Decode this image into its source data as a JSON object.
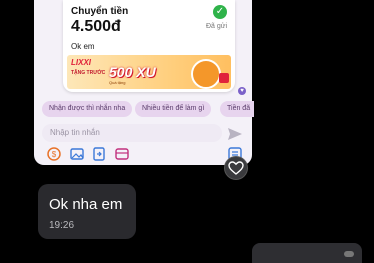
{
  "transfer": {
    "title": "Chuyển tiền",
    "amount": "4.500đ",
    "status": "Đã gửi",
    "note": "Ok em"
  },
  "promo": {
    "brand": "LIXXI",
    "tagline": "TẶNG TRƯỚC",
    "amount": "500 XU",
    "small": "Quà tặng"
  },
  "suggestions": [
    "Nhận được thì nhắn nha",
    "Nhiều tiền để làm gì",
    "Tiền đã"
  ],
  "composer": {
    "placeholder": "Nhập tin nhắn"
  },
  "toolbar": {
    "icons": [
      "money-icon",
      "image-icon",
      "transfer-icon",
      "gift-icon",
      "sticker-icon"
    ]
  },
  "message": {
    "text": "Ok nha em",
    "time": "19:26"
  },
  "colors": {
    "accent": "#7b61c9",
    "chip_bg": "#e7d4ee",
    "check": "#2fb34a",
    "bubble": "#2a2a2e"
  }
}
